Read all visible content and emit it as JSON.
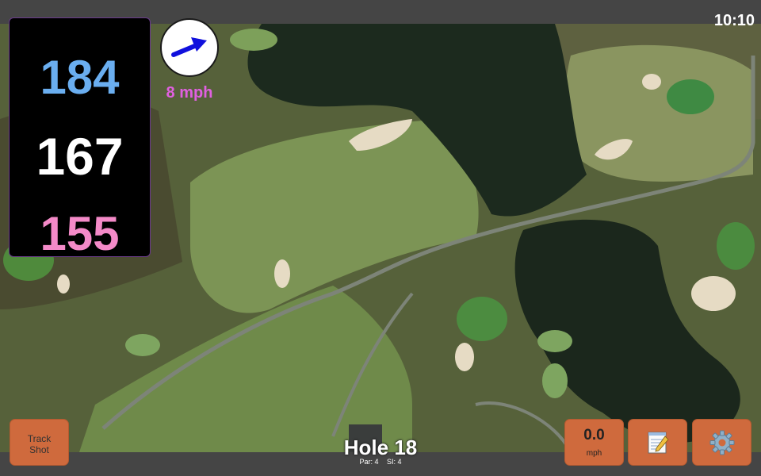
{
  "status": {
    "time": "10:10"
  },
  "distances": {
    "back": "184",
    "middle": "167",
    "front": "155"
  },
  "wind": {
    "speed_label": "8 mph",
    "button_value": "0.0",
    "button_unit": "mph"
  },
  "hole": {
    "title": "Hole 18",
    "par": "Par: 4",
    "si": "SI: 4"
  },
  "buttons": {
    "track_shot_line1": "Track",
    "track_shot_line2": "Shot"
  },
  "icons": {
    "wind_arrow": "arrow-icon",
    "notes": "notepad-icon",
    "settings": "gear-icon"
  },
  "colors": {
    "back": "#6aaef0",
    "middle": "#ffffff",
    "front": "#f48ac8",
    "wind_text": "#e060e0",
    "button": "#cf6a3d",
    "arrow": "#1010dd"
  }
}
